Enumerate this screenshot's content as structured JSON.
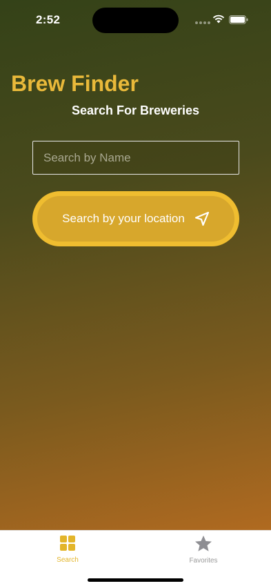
{
  "status_bar": {
    "time": "2:52"
  },
  "app": {
    "title": "Brew Finder",
    "subtitle": "Search For Breweries",
    "accent_color": "#e9b93a"
  },
  "search": {
    "placeholder": "Search by Name",
    "value": ""
  },
  "location_button": {
    "label": "Search by your location",
    "icon": "location-arrow-icon"
  },
  "tab_bar": {
    "tabs": [
      {
        "label": "Search",
        "icon": "grid-icon",
        "selected": true
      },
      {
        "label": "Favorites",
        "icon": "star-icon",
        "selected": false
      }
    ]
  }
}
